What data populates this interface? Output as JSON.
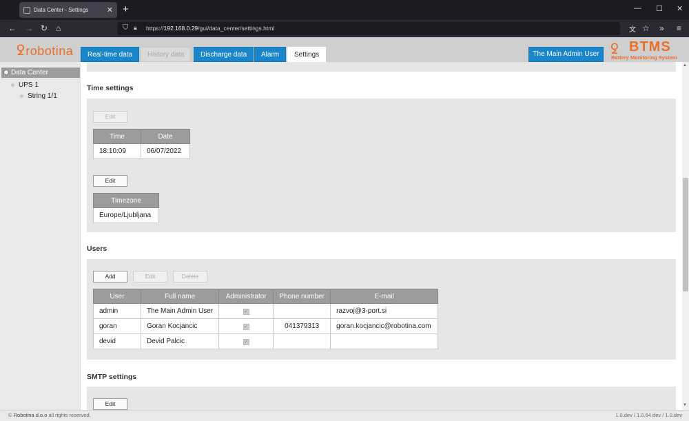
{
  "browser": {
    "tab_title": "Data Center - Settings",
    "new_tab": "+",
    "url_prefix": "https://",
    "url_host": "192.168.0.29",
    "url_path": "/gui/data_center/settings.html",
    "minimize": "—",
    "maximize": "☐",
    "close": "✕"
  },
  "header": {
    "logo_text": "robotina",
    "tabs": [
      {
        "label": "Real-time data",
        "state": "normal"
      },
      {
        "label": "History data",
        "state": "disabled"
      },
      {
        "label": "Discharge data",
        "state": "normal"
      },
      {
        "label": "Alarm",
        "state": "normal"
      },
      {
        "label": "Settings",
        "state": "active"
      }
    ],
    "user_button": "The Main Admin User",
    "btms_title": "BTMS",
    "btms_subtitle": "Battery Monitoring System",
    "accent_color": "#1a85c8",
    "brand_color": "#e8702a"
  },
  "sidebar": {
    "root": "Data Center",
    "items": [
      {
        "label": "UPS 1",
        "level": 1
      },
      {
        "label": "String 1/1",
        "level": 2
      }
    ]
  },
  "time_settings": {
    "title": "Time settings",
    "edit_label": "Edit",
    "columns": [
      "Time",
      "Date"
    ],
    "time": "18:10:09",
    "date": "06/07/2022",
    "timezone_edit_label": "Edit",
    "timezone_header": "Timezone",
    "timezone": "Europe/Ljubljana"
  },
  "users": {
    "title": "Users",
    "add_label": "Add",
    "edit_label": "Edit",
    "delete_label": "Delete",
    "columns": [
      "User",
      "Full name",
      "Administrator",
      "Phone number",
      "E-mail"
    ],
    "rows": [
      {
        "user": "admin",
        "full_name": "The Main Admin User",
        "admin": true,
        "phone": "",
        "email": "razvoj@3-port.si"
      },
      {
        "user": "goran",
        "full_name": "Goran Kocjancic",
        "admin": true,
        "phone": "041379313",
        "email": "goran.kocjancic@robotina.com"
      },
      {
        "user": "devid",
        "full_name": "Devid Palcic",
        "admin": true,
        "phone": "",
        "email": ""
      }
    ]
  },
  "smtp": {
    "title": "SMTP settings",
    "edit_label": "Edit"
  },
  "footer": {
    "copyright": "© ",
    "brand": "Robotina d.o.o",
    "rights": " all rights reserved.",
    "version": "1.0.dev / 1.0.64.dev / 1.0.dev"
  }
}
